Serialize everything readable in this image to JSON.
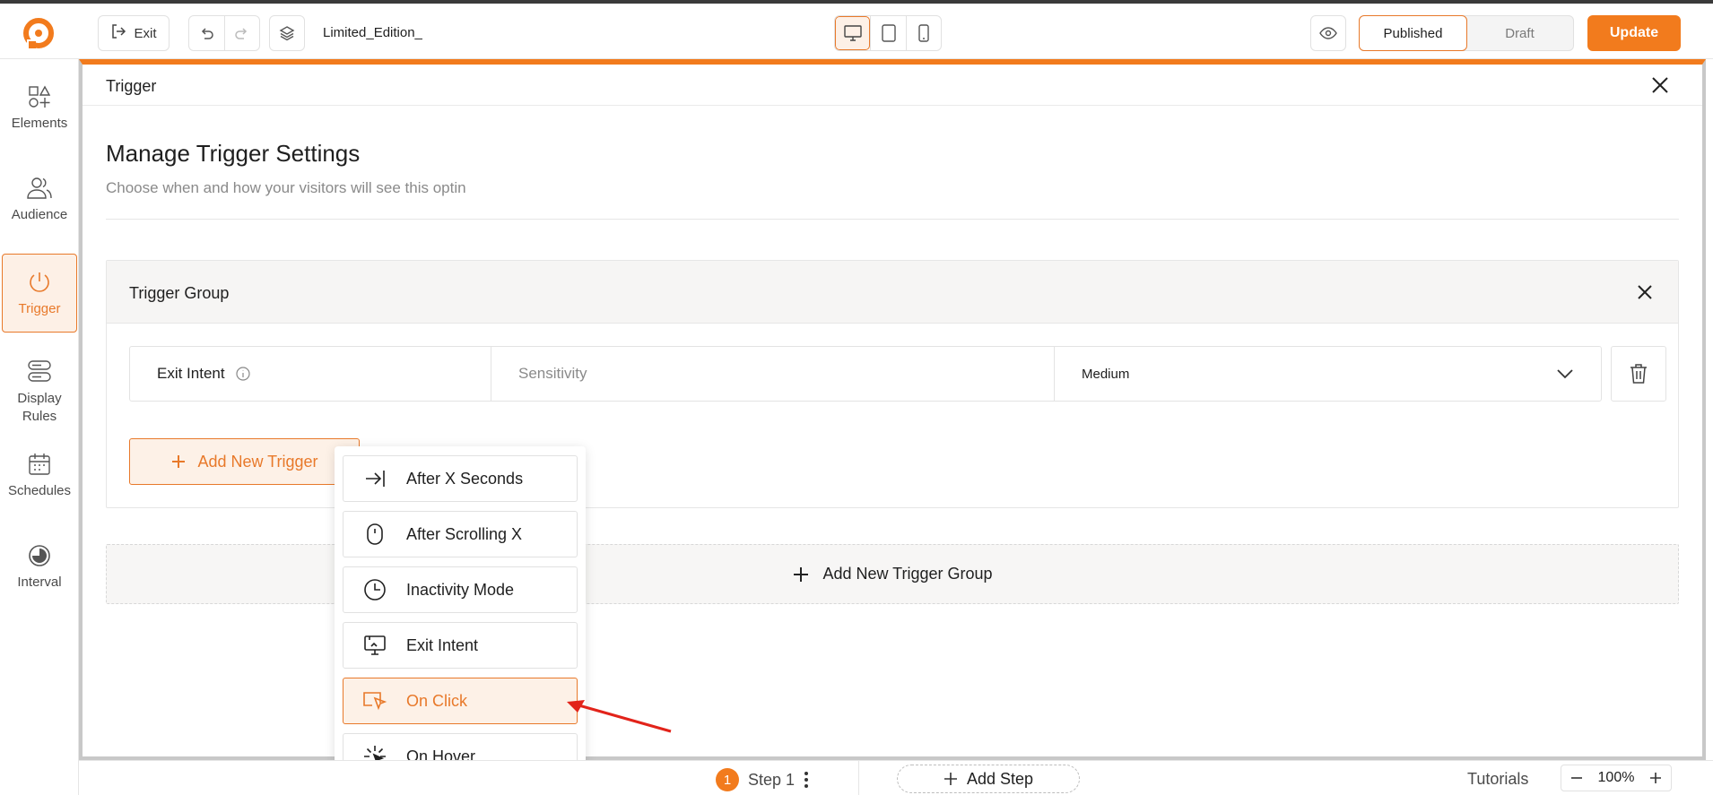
{
  "topbar": {
    "exit_label": "Exit",
    "doc_title": "Limited_Edition_",
    "status_published": "Published",
    "status_draft": "Draft",
    "update_label": "Update",
    "accent_color": "#f27b1d"
  },
  "sidebar": {
    "items": [
      {
        "label": "Elements",
        "icon": "elements-icon"
      },
      {
        "label": "Audience",
        "icon": "audience-icon"
      },
      {
        "label": "Trigger",
        "icon": "power-icon"
      },
      {
        "label": "Display Rules",
        "icon": "display-rules-icon"
      },
      {
        "label": "Schedules",
        "icon": "calendar-icon"
      },
      {
        "label": "Interval",
        "icon": "interval-icon"
      }
    ],
    "active": "Trigger"
  },
  "panel": {
    "title": "Trigger",
    "heading": "Manage Trigger Settings",
    "subheading": "Choose when and how your visitors will see this optin"
  },
  "group": {
    "title": "Trigger Group",
    "row": {
      "name": "Exit Intent",
      "field_label": "Sensitivity",
      "field_value": "Medium"
    },
    "add_trigger_label": "Add New Trigger"
  },
  "add_group_label": "Add New Trigger Group",
  "dropdown": {
    "items": [
      {
        "label": "After X Seconds",
        "icon": "arrow-to-line-icon"
      },
      {
        "label": "After Scrolling X",
        "icon": "mouse-icon"
      },
      {
        "label": "Inactivity Mode",
        "icon": "clock-icon"
      },
      {
        "label": "Exit Intent",
        "icon": "exit-screen-icon"
      },
      {
        "label": "On Click",
        "icon": "pointer-click-icon"
      },
      {
        "label": "On Hover",
        "icon": "hover-burst-icon"
      }
    ],
    "selected": "On Click"
  },
  "bottom": {
    "step_number": "1",
    "step_label": "Step 1",
    "add_step_label": "Add Step",
    "tutorials_label": "Tutorials",
    "zoom_value": "100%"
  }
}
